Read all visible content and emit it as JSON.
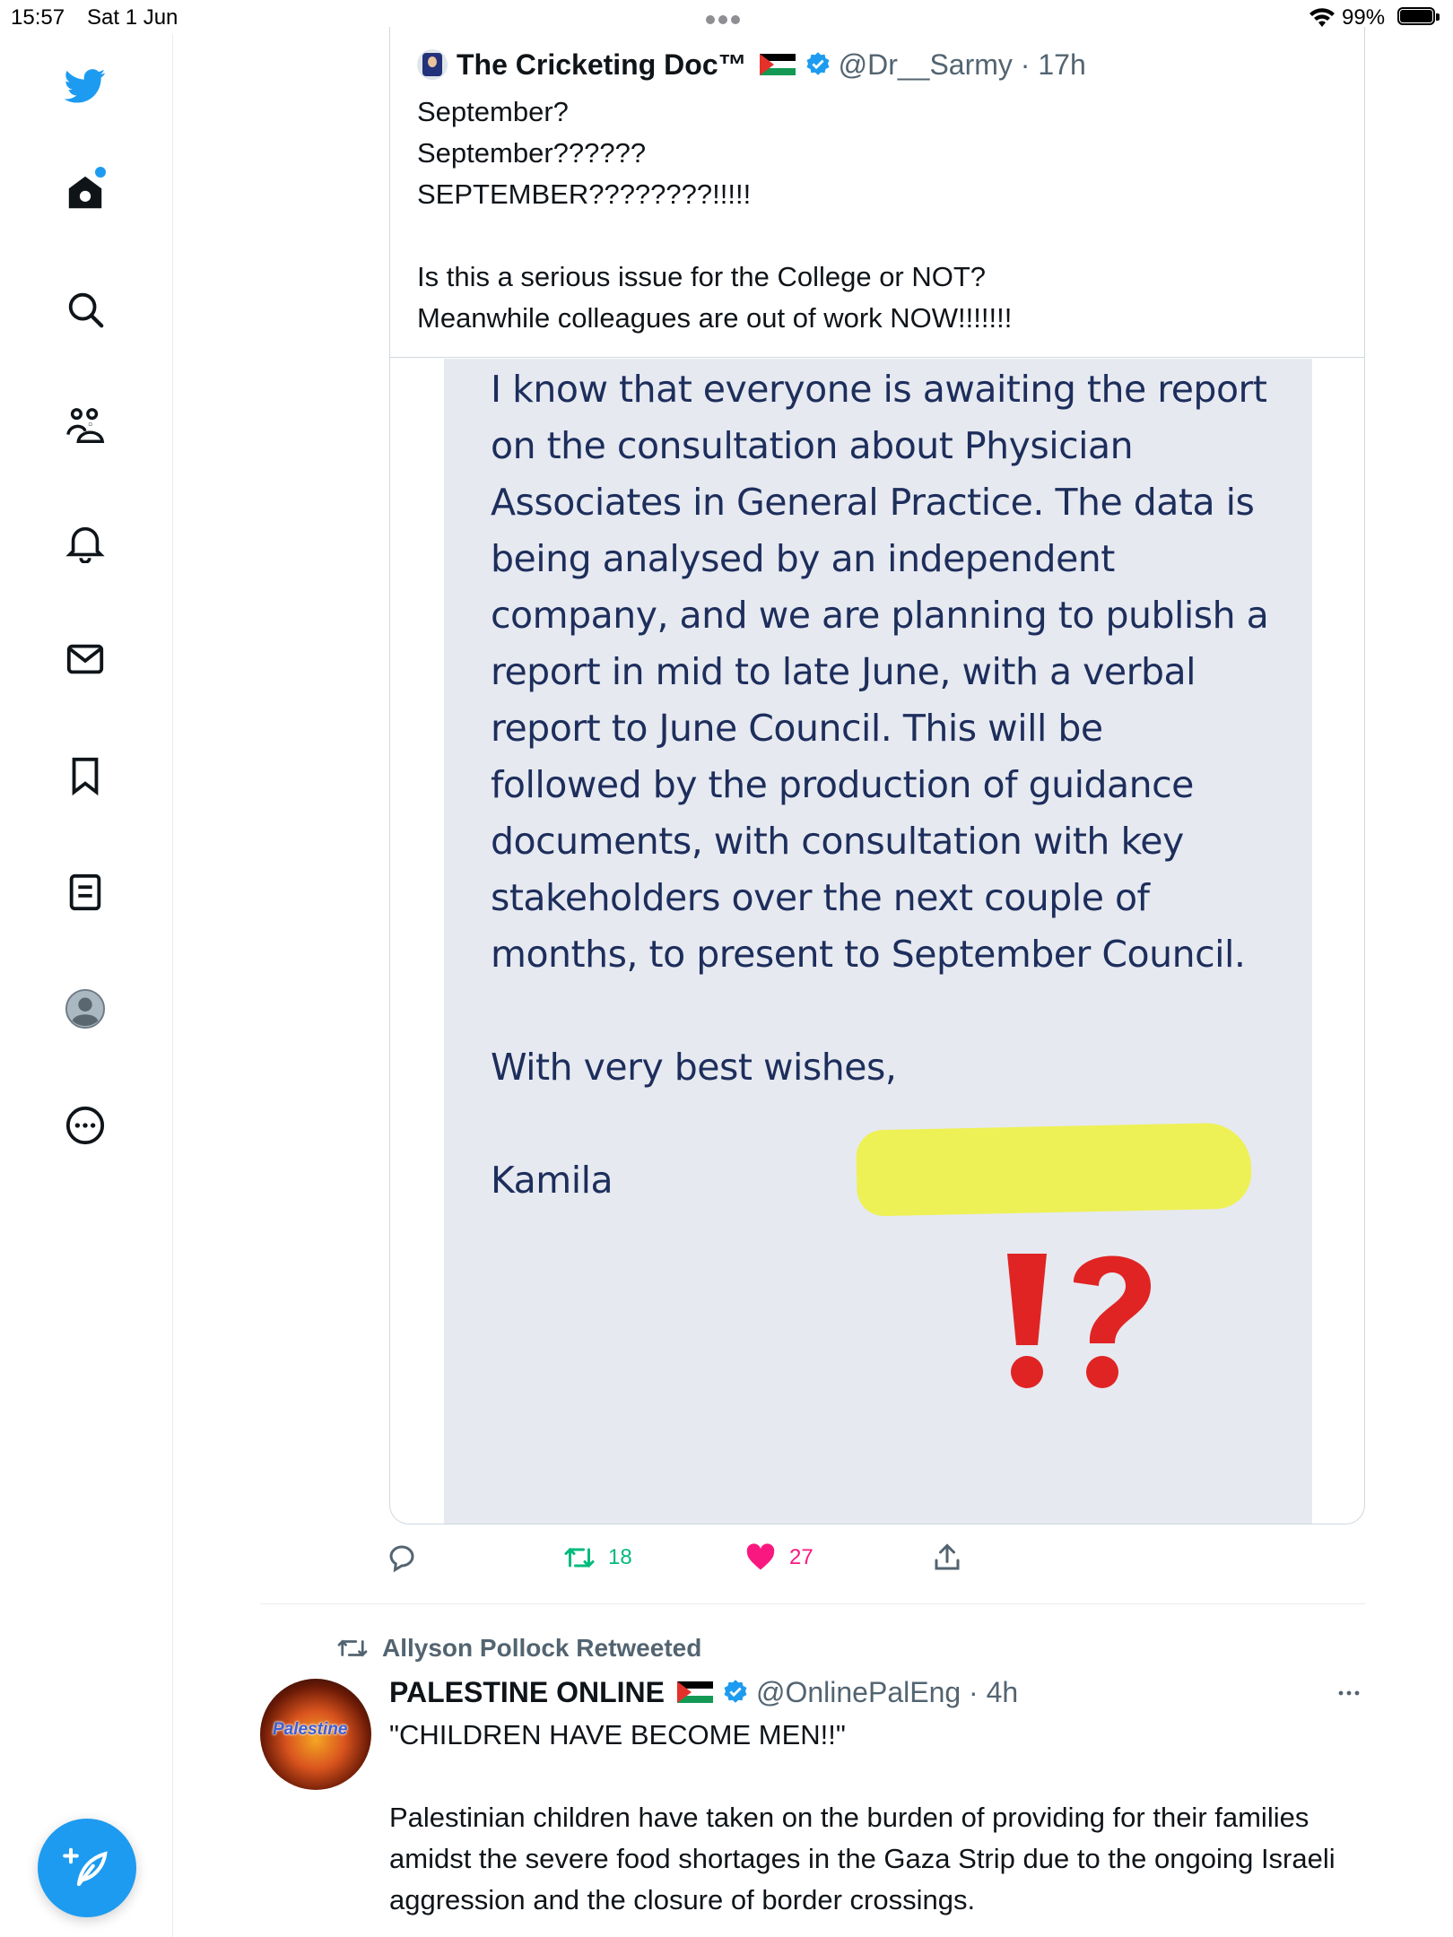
{
  "status_bar": {
    "time": "15:57",
    "date": "Sat 1 Jun",
    "battery": "99%"
  },
  "sidebar": {
    "items": [
      {
        "icon": "twitter-bird-icon"
      },
      {
        "icon": "home-icon"
      },
      {
        "icon": "search-icon"
      },
      {
        "icon": "communities-icon"
      },
      {
        "icon": "notifications-bell-icon"
      },
      {
        "icon": "messages-envelope-icon"
      },
      {
        "icon": "bookmark-icon"
      },
      {
        "icon": "lists-icon"
      },
      {
        "icon": "profile-avatar-icon"
      },
      {
        "icon": "more-icon"
      }
    ],
    "compose_icon": "compose-feather-icon"
  },
  "quoted_tweet": {
    "author_name": "The Cricketing Doc™",
    "handle_time": "@Dr__Sarmy · 17h",
    "text": "September?\nSeptember??????\nSEPTEMBER????????!!!!!\n\nIs this a serious issue for the College or NOT?\nMeanwhile colleagues are out of work NOW!!!!!!!",
    "image_lines": [
      "I know that everyone is awaiting the report",
      "on the consultation about Physician",
      "Associates in General Practice. The data is",
      "being analysed by an independent",
      "company, and we are planning to publish a",
      "report in mid to late June, with a verbal",
      "report to June Council. This will be",
      "followed by the production of guidance",
      "documents, with consultation with key",
      "stakeholders over the next couple of",
      "months, to present to September Council.",
      "With very best wishes,",
      "Kamila"
    ]
  },
  "actions": {
    "retweets": "18",
    "likes": "27"
  },
  "retweet_tweet": {
    "retweeted_by": "Allyson Pollock Retweeted",
    "avatar_label": "Palestine",
    "author_name": "PALESTINE ONLINE",
    "handle_time": "@OnlinePalEng · 4h",
    "text": "\"CHILDREN HAVE BECOME MEN!!\"\n\nPalestinian children have taken on the burden of providing for their families amidst the severe food shortages in the Gaza Strip due to the ongoing Israeli aggression and the closure of border crossings."
  },
  "colors": {
    "accent": "#1d9bf0",
    "like": "#f91880",
    "retweet": "#00ba7c",
    "secondary_text": "#536471",
    "image_text": "#1d2e5c",
    "image_bg": "#e6e9f0",
    "highlight": "#eef23a"
  }
}
